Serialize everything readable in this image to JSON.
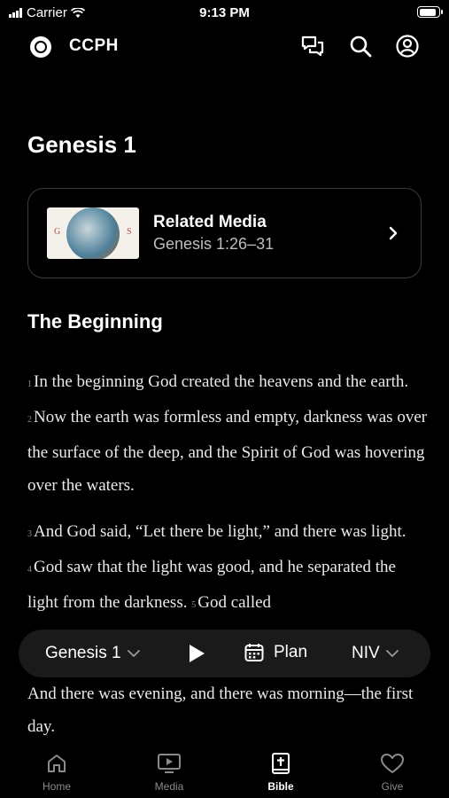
{
  "status": {
    "carrier": "Carrier",
    "time": "9:13 PM",
    "battery_level": 0.9
  },
  "header": {
    "app_name": "CCPH"
  },
  "page": {
    "title": "Genesis 1"
  },
  "related": {
    "title": "Related Media",
    "reference": "Genesis 1:26–31",
    "thumb_letters": [
      "G",
      "S"
    ]
  },
  "section": {
    "heading": "The Beginning"
  },
  "scripture": {
    "p1": [
      {
        "n": "1",
        "t": "In the beginning God created the heavens and the earth."
      },
      {
        "n": "2",
        "t": "Now the earth was formless and empty, darkness was over the surface of the deep, and the Spirit of God was hovering over the waters."
      }
    ],
    "p2": [
      {
        "n": "3",
        "t": "And God said, “Let there be light,” and there was light."
      },
      {
        "n": "4",
        "t": "God saw that the light was good, and he separated the light from the darkness."
      },
      {
        "n": "5",
        "t": "God called"
      }
    ],
    "after": "And there was evening, and there was morning—the first day."
  },
  "player": {
    "chapter": "Genesis 1",
    "plan_label": "Plan",
    "version": "NIV"
  },
  "tabs": [
    {
      "label": "Home",
      "icon": "home-icon"
    },
    {
      "label": "Media",
      "icon": "media-icon"
    },
    {
      "label": "Bible",
      "icon": "bible-icon"
    },
    {
      "label": "Give",
      "icon": "heart-icon"
    }
  ],
  "colors": {
    "background": "#000000",
    "card_border": "#3a3a3a",
    "player_bg": "#1a1a1a",
    "muted": "#8a8a8a"
  }
}
